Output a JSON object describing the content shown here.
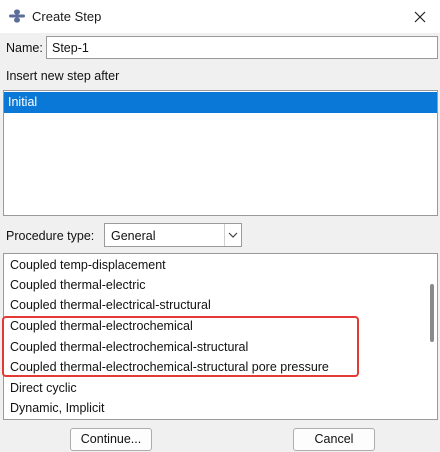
{
  "window": {
    "title": "Create Step"
  },
  "name_field": {
    "label": "Name:",
    "value": "Step-1"
  },
  "insert_after": {
    "label": "Insert new step after",
    "items": [
      "Initial"
    ],
    "selected": "Initial"
  },
  "procedure": {
    "label": "Procedure type:",
    "selected": "General",
    "items": [
      "Coupled temp-displacement",
      "Coupled thermal-electric",
      "Coupled thermal-electrical-structural",
      "Coupled thermal-electrochemical",
      "Coupled thermal-electrochemical-structural",
      "Coupled thermal-electrochemical-structural pore pressure",
      "Direct cyclic",
      "Dynamic, Implicit"
    ]
  },
  "buttons": {
    "continue": "Continue...",
    "cancel": "Cancel"
  },
  "colors": {
    "selection": "#0a78d7",
    "highlight_border": "#e53935"
  }
}
